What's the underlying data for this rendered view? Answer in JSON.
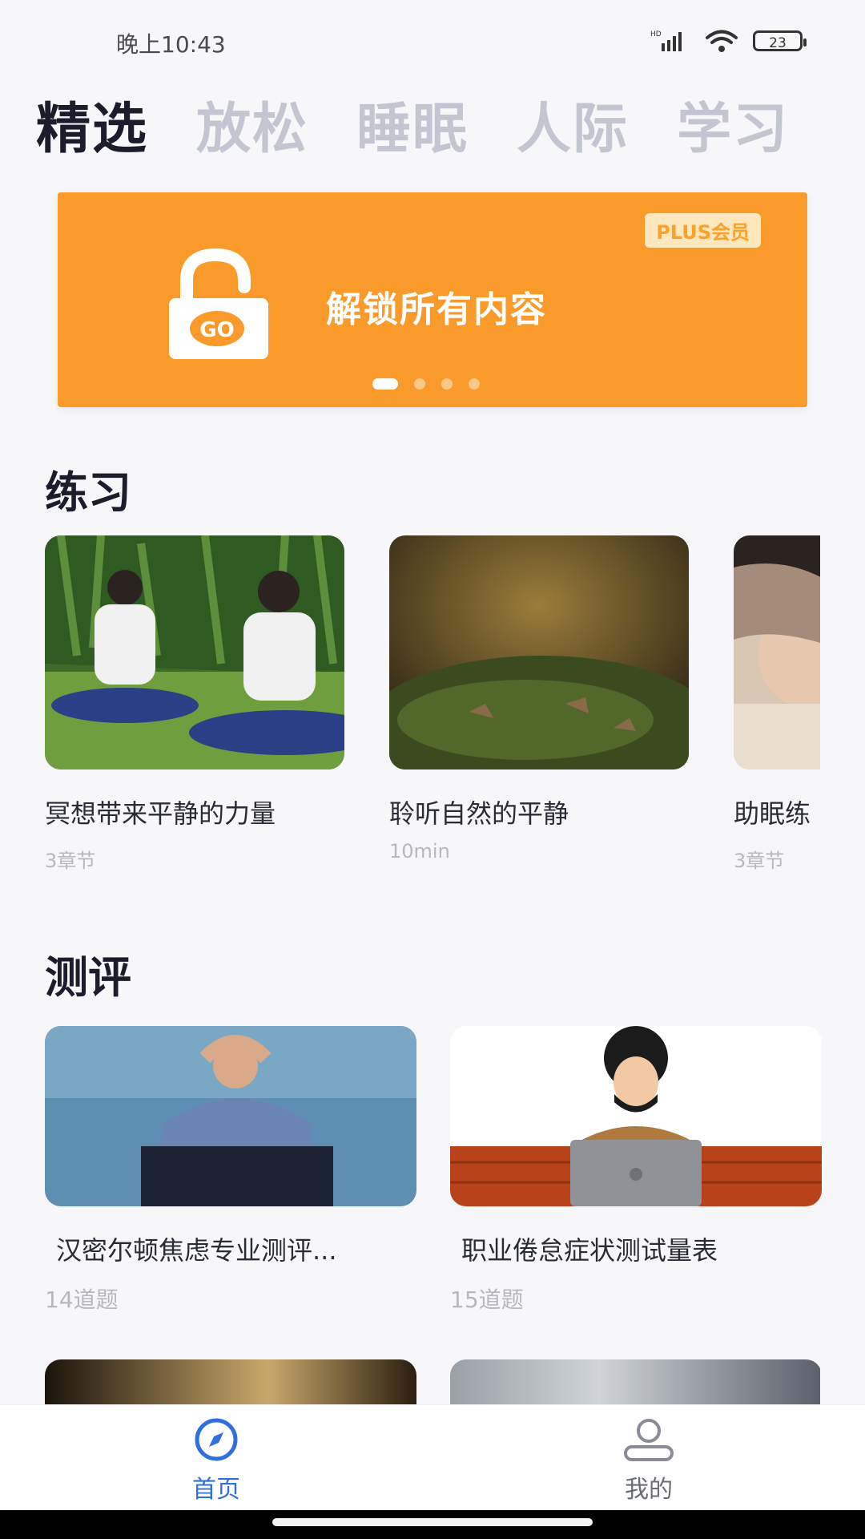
{
  "status": {
    "time": "晚上10:43",
    "battery": "23",
    "network": "HD"
  },
  "tabs": [
    {
      "label": "精选",
      "active": true
    },
    {
      "label": "放松"
    },
    {
      "label": "睡眠"
    },
    {
      "label": "人际"
    },
    {
      "label": "学习"
    }
  ],
  "banner": {
    "badge": "PLUS会员",
    "lock_text": "GO",
    "text": "解锁所有内容",
    "background": "#f99a2a",
    "slide_count": 4,
    "active_slide": 1
  },
  "practice": {
    "title": "练习",
    "items": [
      {
        "title": "冥想带来平静的力量",
        "meta": "3章节"
      },
      {
        "title": "聆听自然的平静",
        "meta": "10min"
      },
      {
        "title": "助眠练",
        "meta": "3章节"
      }
    ]
  },
  "evaluation": {
    "title": "测评",
    "items": [
      {
        "title": "汉密尔顿焦虑专业测评...",
        "meta": "14道题"
      },
      {
        "title": "职业倦怠症状测试量表",
        "meta": "15道题"
      }
    ]
  },
  "bottom_nav": {
    "items": [
      {
        "label": "首页",
        "icon": "compass-icon",
        "active": true
      },
      {
        "label": "我的",
        "icon": "user-icon"
      }
    ],
    "active_color": "#2f6fe0",
    "inactive_color": "#6a6d75"
  }
}
